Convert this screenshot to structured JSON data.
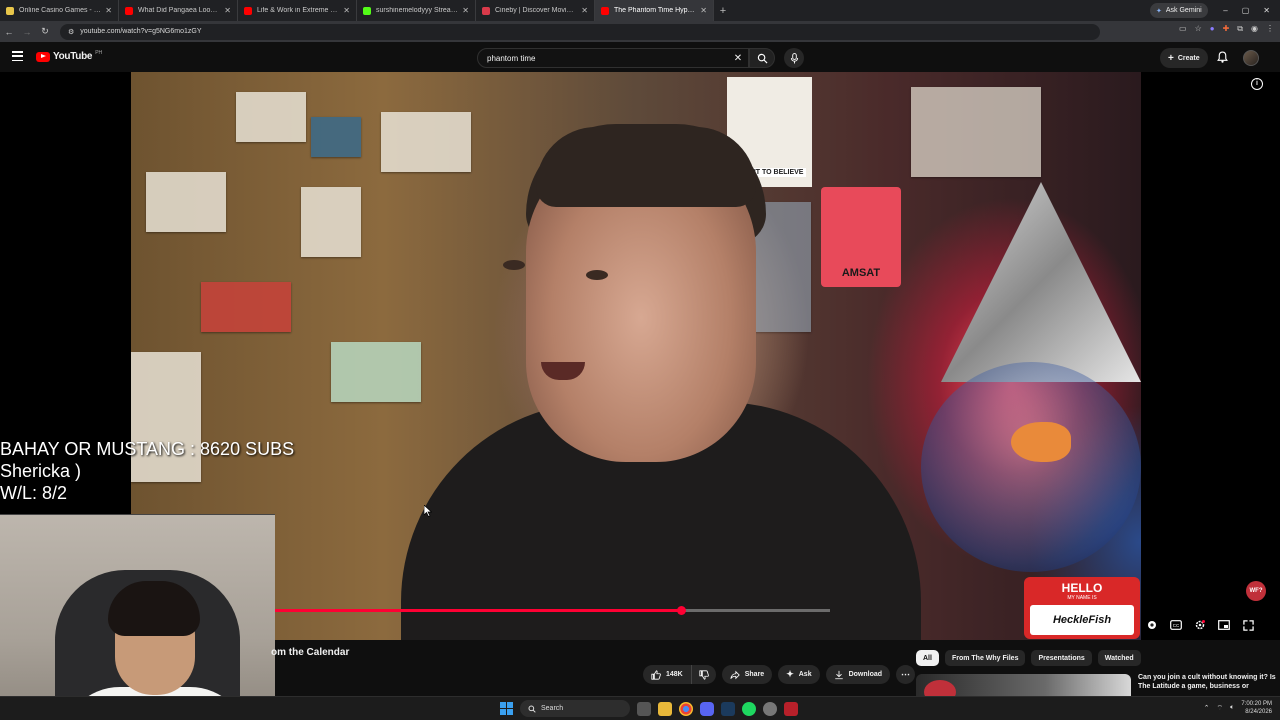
{
  "browser": {
    "tabs": [
      {
        "label": "Online Casino Games - Play Fre",
        "favicon_color": "#e8c64a",
        "favicon_glyph": "$",
        "active": false
      },
      {
        "label": "What Did Pangaea Look like?",
        "favicon_color": "#ff0000",
        "favicon_glyph": "",
        "active": false
      },
      {
        "label": "Life & Work in Extreme Conditi",
        "favicon_color": "#ff0000",
        "favicon_glyph": "",
        "active": false
      },
      {
        "label": "surshinemelodyyy Stream - Wa",
        "favicon_color": "#53fc18",
        "favicon_glyph": "K",
        "active": false
      },
      {
        "label": "Cineby | Discover Movies & TV",
        "favicon_color": "#d93a4a",
        "favicon_glyph": "",
        "active": false
      },
      {
        "label": "The Phantom Time Hypothesis",
        "favicon_color": "#ff0000",
        "favicon_glyph": "",
        "active": true
      }
    ],
    "new_tab_glyph": "+",
    "ask_gemini_label": "Ask Gemini",
    "url": "youtube.com/watch?v=g5NG6mo1zGY",
    "window_controls": [
      "–",
      "▢",
      "✕"
    ]
  },
  "masthead": {
    "logo_text": "YouTube",
    "country_code": "PH",
    "search_value": "phantom time",
    "create_label": "Create"
  },
  "player": {
    "overlay_lines": [
      "BAHAY OR MUSTANG : 8620 SUBS",
      "Shericka )",
      "W/L: 8/2"
    ],
    "progress_fraction": 0.731,
    "buffered_fraction": 1.0,
    "channel_badge": "WF?",
    "scene_text": {
      "sign_amsat": "AMSAT",
      "poster": "I WANT TO BELIEVE",
      "hello": "HELLO",
      "my_name_is": "MY NAME IS",
      "name_tag": "HeckleFish"
    }
  },
  "below": {
    "title_visible": "om the Calendar",
    "like_count": "148K",
    "share_label": "Share",
    "ask_label": "Ask",
    "download_label": "Download",
    "chips": [
      "All",
      "From The Why Files",
      "Presentations",
      "Watched"
    ],
    "active_chip": "All",
    "rec_title": "Can you join a cult without knowing it? Is The Latitude a game, business or"
  },
  "taskbar": {
    "search_label": "Search",
    "time": "7:00:20 PM",
    "date": "8/24/2026"
  },
  "colors": {
    "accent_red": "#ff0033",
    "yt_red": "#ff0000",
    "bg": "#0f0f0f"
  }
}
